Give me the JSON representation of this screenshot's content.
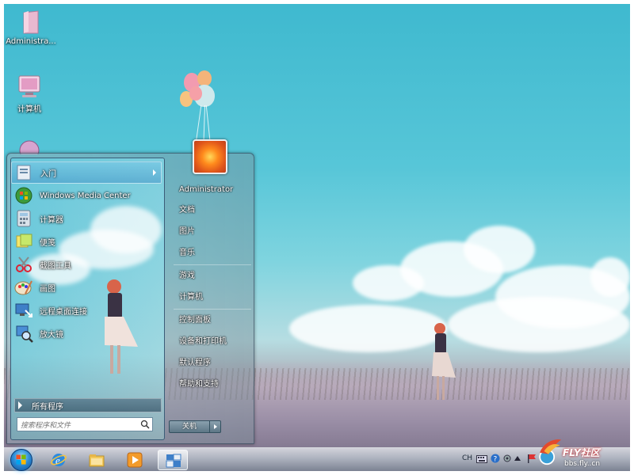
{
  "desktop": {
    "icons": [
      {
        "label": "Administra..."
      },
      {
        "label": "计算机"
      }
    ]
  },
  "start_menu": {
    "programs": [
      {
        "label": "入门",
        "icon": "getting-started-icon",
        "has_submenu": true
      },
      {
        "label": "Windows Media Center",
        "icon": "media-center-icon"
      },
      {
        "label": "计算器",
        "icon": "calculator-icon"
      },
      {
        "label": "便笺",
        "icon": "sticky-notes-icon"
      },
      {
        "label": "截图工具",
        "icon": "snipping-tool-icon"
      },
      {
        "label": "画图",
        "icon": "paint-icon"
      },
      {
        "label": "远程桌面连接",
        "icon": "remote-desktop-icon"
      },
      {
        "label": "放大镜",
        "icon": "magnifier-icon"
      }
    ],
    "all_programs": "所有程序",
    "search_placeholder": "搜索程序和文件",
    "right_items": [
      {
        "label": "Administrator"
      },
      {
        "label": "文档"
      },
      {
        "label": "图片"
      },
      {
        "label": "音乐"
      },
      {
        "label": "游戏"
      },
      {
        "label": "计算机"
      },
      {
        "label": "控制面板"
      },
      {
        "label": "设备和打印机"
      },
      {
        "label": "默认程序"
      },
      {
        "label": "帮助和支持"
      }
    ],
    "shutdown_label": "关机"
  },
  "taskbar": {
    "pinned": [
      "internet-explorer-icon",
      "explorer-folder-icon",
      "media-player-icon",
      "active-window-icon"
    ],
    "tray": {
      "language": "CH"
    }
  },
  "watermark": {
    "text": "FLY社区",
    "url": "bbs.fly..cn"
  },
  "colors": {
    "sky": "#4fc0d4",
    "taskbar": "#9aa6b2",
    "accent": "#2f8fd8"
  }
}
